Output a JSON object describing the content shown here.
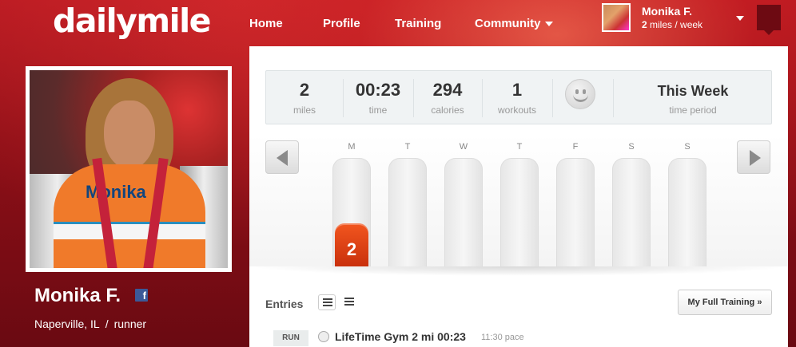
{
  "header": {
    "logo": "dailymile",
    "nav": [
      "Home",
      "Profile",
      "Training",
      "Community"
    ],
    "user": {
      "name": "Monika F.",
      "miles": "2",
      "miles_suffix": " miles / week"
    }
  },
  "profile": {
    "name": "Monika F.",
    "fb_icon": "f",
    "location": "Naperville, IL",
    "separator": "/",
    "role": "runner",
    "photo_text": "Monika"
  },
  "stats": [
    {
      "value": "2",
      "label": "miles"
    },
    {
      "value": "00:23",
      "label": "time"
    },
    {
      "value": "294",
      "label": "calories"
    },
    {
      "value": "1",
      "label": "workouts"
    }
  ],
  "period": {
    "value": "This Week",
    "label": "time period"
  },
  "chart_data": {
    "type": "bar",
    "categories": [
      "M",
      "T",
      "W",
      "T",
      "F",
      "S",
      "S"
    ],
    "values": [
      2,
      0,
      0,
      0,
      0,
      0,
      0
    ],
    "ylim": [
      0,
      5
    ],
    "value_labels": [
      "2",
      "",
      "",
      "",
      "",
      "",
      ""
    ]
  },
  "entries": {
    "title": "Entries",
    "full_training": "My Full Training »",
    "items": [
      {
        "tag": "RUN",
        "title": "LifeTime Gym 2 mi 00:23",
        "pace": "11:30 pace"
      }
    ]
  },
  "colors": {
    "brand_red": "#b4161f",
    "bar_orange": "#e24a16"
  }
}
